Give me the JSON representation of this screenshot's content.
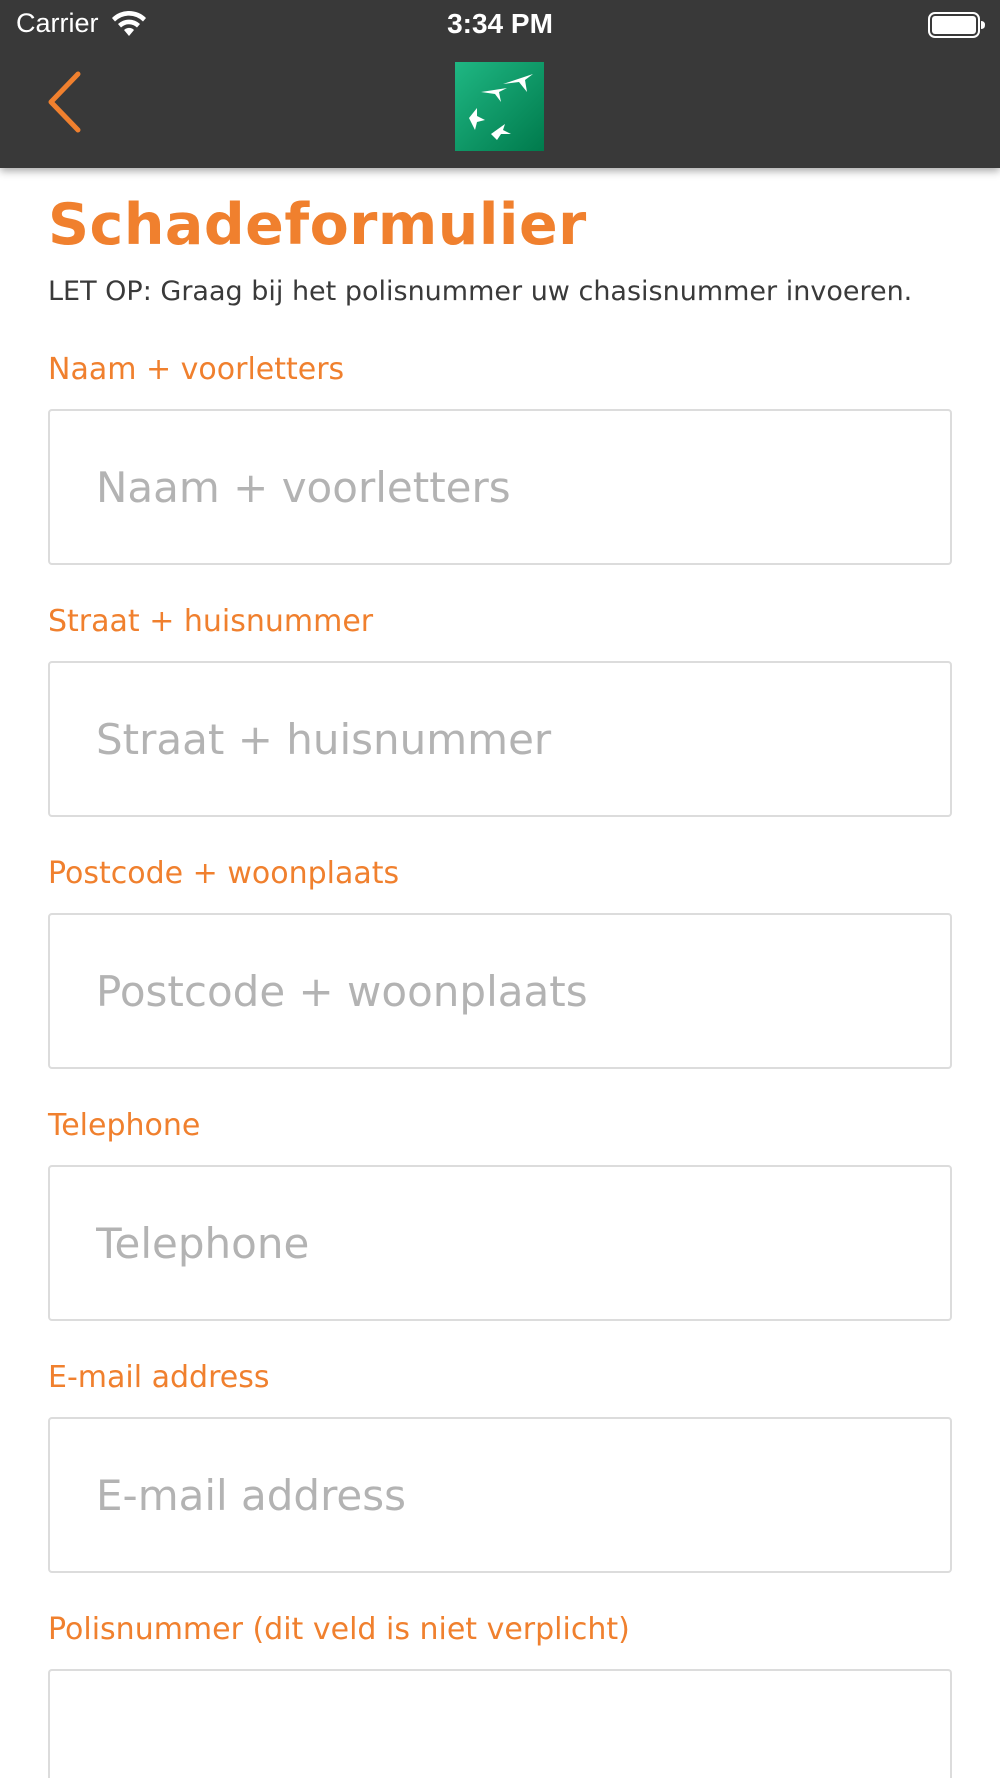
{
  "status_bar": {
    "carrier": "Carrier",
    "time": "3:34 PM",
    "battery_icon": "battery-full-icon",
    "wifi_icon": "wifi-icon"
  },
  "nav_bar": {
    "back_icon": "chevron-left-icon",
    "logo_icon": "bnp-paribas-logo",
    "accent_color": "#f0802e",
    "background_color": "#393939"
  },
  "form": {
    "title": "Schadeformulier",
    "notice": "LET OP: Graag bij het polisnummer uw chasisnummer invoeren.",
    "fields": [
      {
        "label": "Naam + voorletters",
        "placeholder": "Naam + voorletters",
        "value": ""
      },
      {
        "label": "Straat + huisnummer",
        "placeholder": "Straat + huisnummer",
        "value": ""
      },
      {
        "label": "Postcode + woonplaats",
        "placeholder": "Postcode + woonplaats",
        "value": ""
      },
      {
        "label": "Telephone",
        "placeholder": "Telephone",
        "value": ""
      },
      {
        "label": "E-mail address",
        "placeholder": "E-mail address",
        "value": ""
      },
      {
        "label": "Polisnummer (dit veld is niet verplicht)",
        "placeholder": "",
        "value": ""
      }
    ]
  }
}
